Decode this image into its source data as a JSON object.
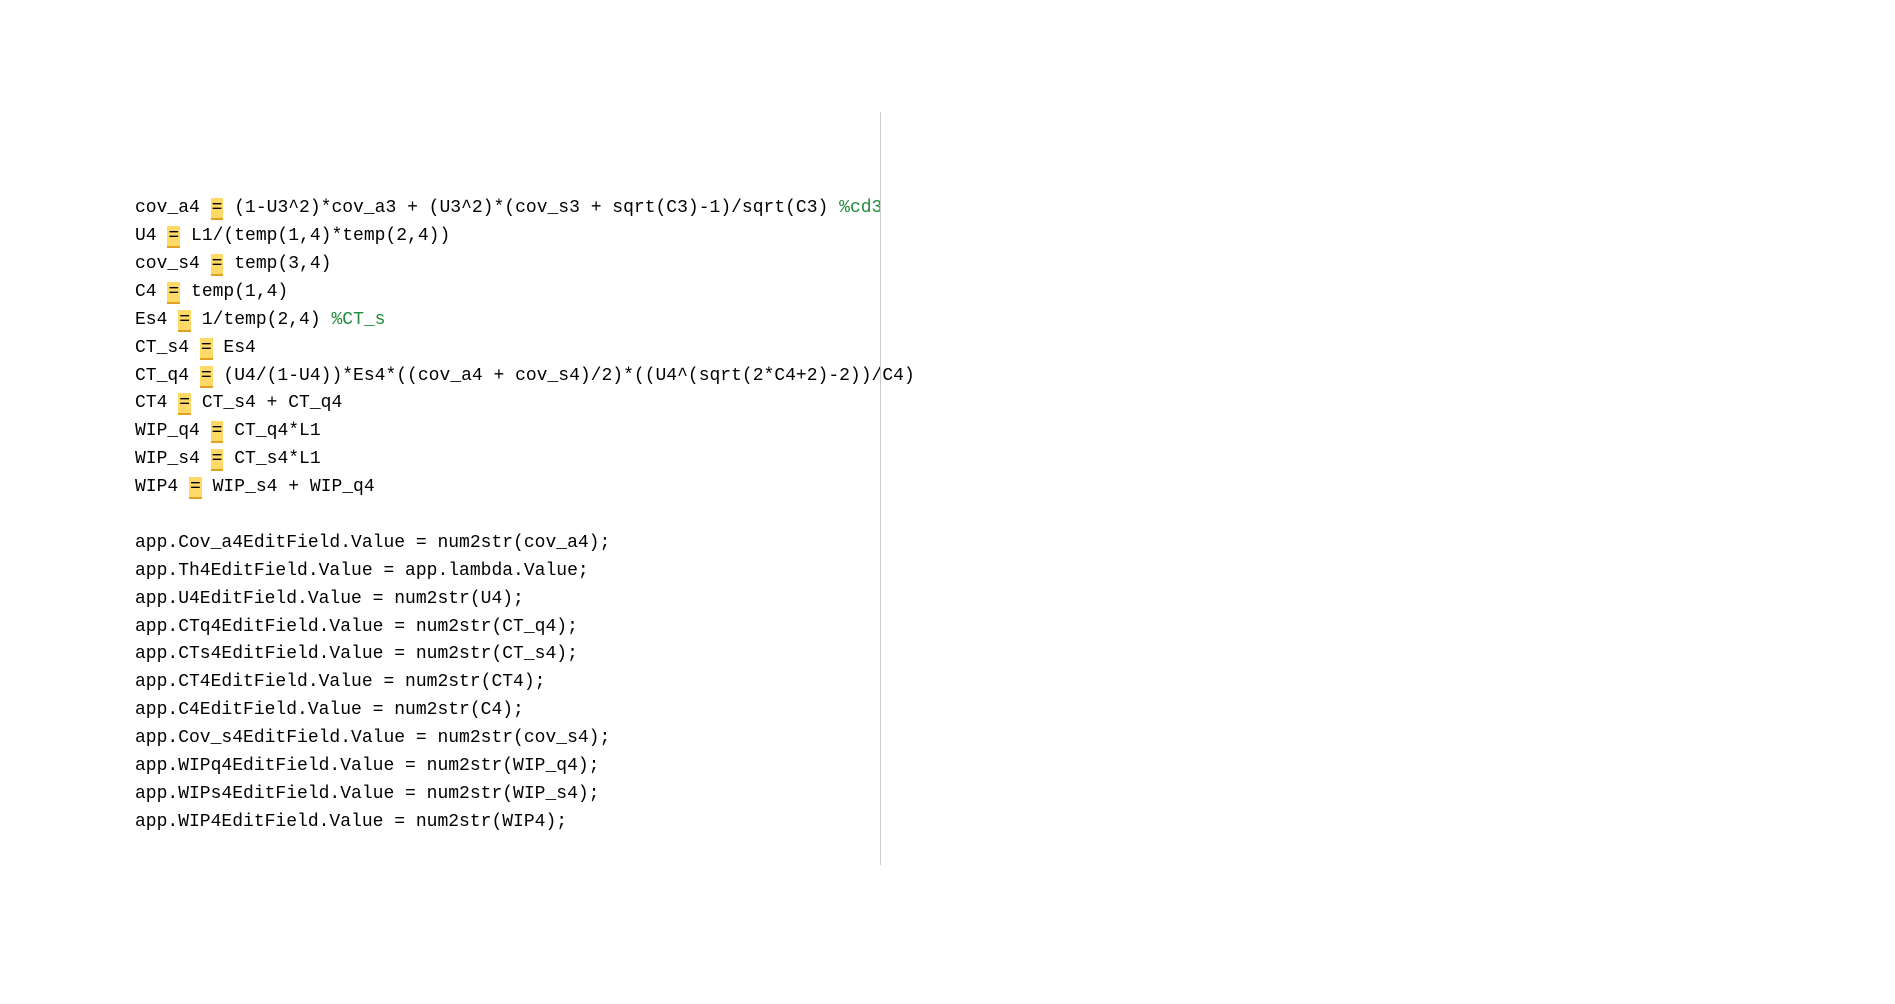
{
  "code": {
    "lines": [
      {
        "pre": "cov_a4 ",
        "eq": "=",
        "post": " (1-U3^2)*cov_a3 + (U3^2)*(cov_s3 + sqrt(C3)-1)/sqrt(C3) ",
        "comment": "%cd3"
      },
      {
        "pre": "U4 ",
        "eq": "=",
        "post": " L1/(temp(1,4)*temp(2,4))"
      },
      {
        "pre": "cov_s4 ",
        "eq": "=",
        "post": " temp(3,4)"
      },
      {
        "pre": "C4 ",
        "eq": "=",
        "post": " temp(1,4)"
      },
      {
        "pre": "Es4 ",
        "eq": "=",
        "post": " 1/temp(2,4) ",
        "comment": "%CT_s"
      },
      {
        "pre": "CT_s4 ",
        "eq": "=",
        "post": " Es4"
      },
      {
        "pre": "CT_q4 ",
        "eq": "=",
        "post": " (U4/(1-U4))*Es4*((cov_a4 + cov_s4)/2)*((U4^(sqrt(2*C4+2)-2))/C4)"
      },
      {
        "pre": "CT4 ",
        "eq": "=",
        "post": " CT_s4 + CT_q4"
      },
      {
        "pre": "WIP_q4 ",
        "eq": "=",
        "post": " CT_q4*L1"
      },
      {
        "pre": "WIP_s4 ",
        "eq": "=",
        "post": " CT_s4*L1"
      },
      {
        "pre": "WIP4 ",
        "eq": "=",
        "post": " WIP_s4 + WIP_q4"
      },
      {
        "pre": ""
      },
      {
        "plain": "app.Cov_a4EditField.Value = num2str(cov_a4);"
      },
      {
        "plain": "app.Th4EditField.Value = app.lambda.Value;"
      },
      {
        "plain": "app.U4EditField.Value = num2str(U4);"
      },
      {
        "plain": "app.CTq4EditField.Value = num2str(CT_q4);"
      },
      {
        "plain": "app.CTs4EditField.Value = num2str(CT_s4);"
      },
      {
        "plain": "app.CT4EditField.Value = num2str(CT4);"
      },
      {
        "plain": "app.C4EditField.Value = num2str(C4);"
      },
      {
        "plain": "app.Cov_s4EditField.Value = num2str(cov_s4);"
      },
      {
        "plain": "app.WIPq4EditField.Value = num2str(WIP_q4);"
      },
      {
        "plain": "app.WIPs4EditField.Value = num2str(WIP_s4);"
      },
      {
        "plain": "app.WIP4EditField.Value = num2str(WIP4);"
      }
    ]
  }
}
